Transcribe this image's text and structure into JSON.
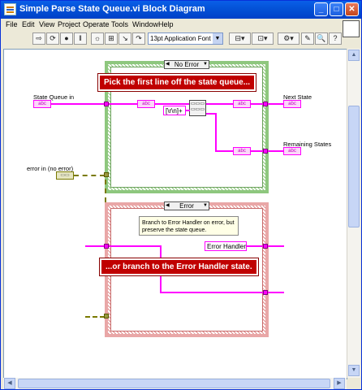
{
  "window": {
    "title": "Simple Parse State Queue.vi Block Diagram",
    "controls": {
      "minimize": "_",
      "maximize": "□",
      "close": "✕"
    }
  },
  "menu": [
    "File",
    "Edit",
    "View",
    "Project",
    "Operate",
    "Tools",
    "Window",
    "Help"
  ],
  "toolbar": {
    "font_selector": "13pt Application Font",
    "icons": [
      "run-arrow-icon",
      "run-continuous-icon",
      "abort-icon",
      "pause-icon",
      "highlight-execution-icon",
      "retain-wire-values-icon",
      "step-into-icon",
      "step-over-icon",
      "step-out-icon",
      "align-objects-icon",
      "distribute-objects-icon",
      "reorder-icon",
      "clean-up-diagram-icon",
      "search-icon",
      "context-help-icon"
    ]
  },
  "diagram": {
    "case_top": {
      "selector": "No Error"
    },
    "case_bottom": {
      "selector": "Error"
    },
    "banner_top": "Pick the first line off the state queue...",
    "banner_bottom": "...or branch to the Error Handler state.",
    "label_state_queue_in": "State Queue in",
    "label_error_in": "error in (no error)",
    "label_next_state": "Next State",
    "label_remaining_states": "Remaining States",
    "regex_constant": "[\\r\\n]+",
    "comment": "Branch to Error Handler on error, but preserve the state queue.",
    "error_handler_constant": "Error Handler",
    "terminal_abc": "abc",
    "terminal_err": "▭▭"
  },
  "colors": {
    "string_wire": "#ff00ff",
    "error_wire": "#7a7a00",
    "case_true": "#8ec77e",
    "case_error": "#e9a7a7",
    "banner": "#c00000"
  }
}
